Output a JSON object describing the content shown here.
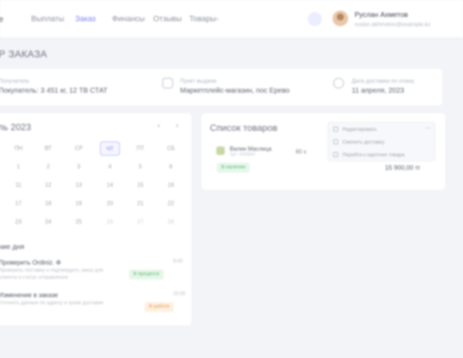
{
  "nav": {
    "logo": "e",
    "links": [
      "Выплаты",
      "Заказ",
      "Финансы",
      "Отзывы",
      "Товары"
    ],
    "active_index": 1
  },
  "user": {
    "name": "Руслан Ахметов",
    "email": "ruslan.akhmetov@example.kz"
  },
  "page": {
    "title": "Р ЗАКАЗА"
  },
  "info": [
    {
      "label": "Получатель",
      "value": "Покупатель: 3 451 кг, 12 ТВ СТАТ"
    },
    {
      "label": "Пункт выдачи",
      "value": "Маркетплейс-магазин, пос Ерево"
    },
    {
      "label": "Дата доставки по плану",
      "value": "11 апреля, 2023"
    }
  ],
  "calendar": {
    "title": "ль 2023",
    "prev": "‹",
    "next": "›",
    "weekdays": [
      "ПН",
      "ВТ",
      "СР",
      "ЧТ",
      "ПТ",
      "СБ"
    ],
    "days": [
      [
        "1",
        "2",
        "3",
        "4",
        "5",
        "6"
      ],
      [
        "11",
        "12",
        "13",
        "14",
        "15",
        "16"
      ],
      [
        "17",
        "18",
        "19",
        "20",
        "21",
        "22"
      ],
      [
        "23",
        "24",
        "25",
        "26",
        "27",
        "28"
      ],
      [
        "29",
        "30",
        "31",
        "1",
        "2",
        "3"
      ]
    ]
  },
  "tasks": {
    "title": "ние дня",
    "items": [
      {
        "name": "Проверить Ordiniz. Ф",
        "desc": "Проверить поставку и подтвердить заказ для клиента и статус отправления",
        "time": "9:00",
        "badge": "В процессе"
      },
      {
        "name": "Изменение в заказе",
        "desc": "Уточнить данные по адресу и сроки доставки",
        "time": "15:00",
        "badge": "В работе"
      }
    ]
  },
  "products": {
    "title": "Список товаров",
    "item": {
      "name": "Валин Маслица",
      "sku": "Арт: 0093847",
      "badge": "В наличии",
      "qty": "80 х",
      "total": "15 900,00 тг"
    }
  },
  "menu": {
    "items": [
      "Редактировать",
      "Сменить доставку",
      "Перейти к карточке товара"
    ],
    "collapse": "—"
  }
}
